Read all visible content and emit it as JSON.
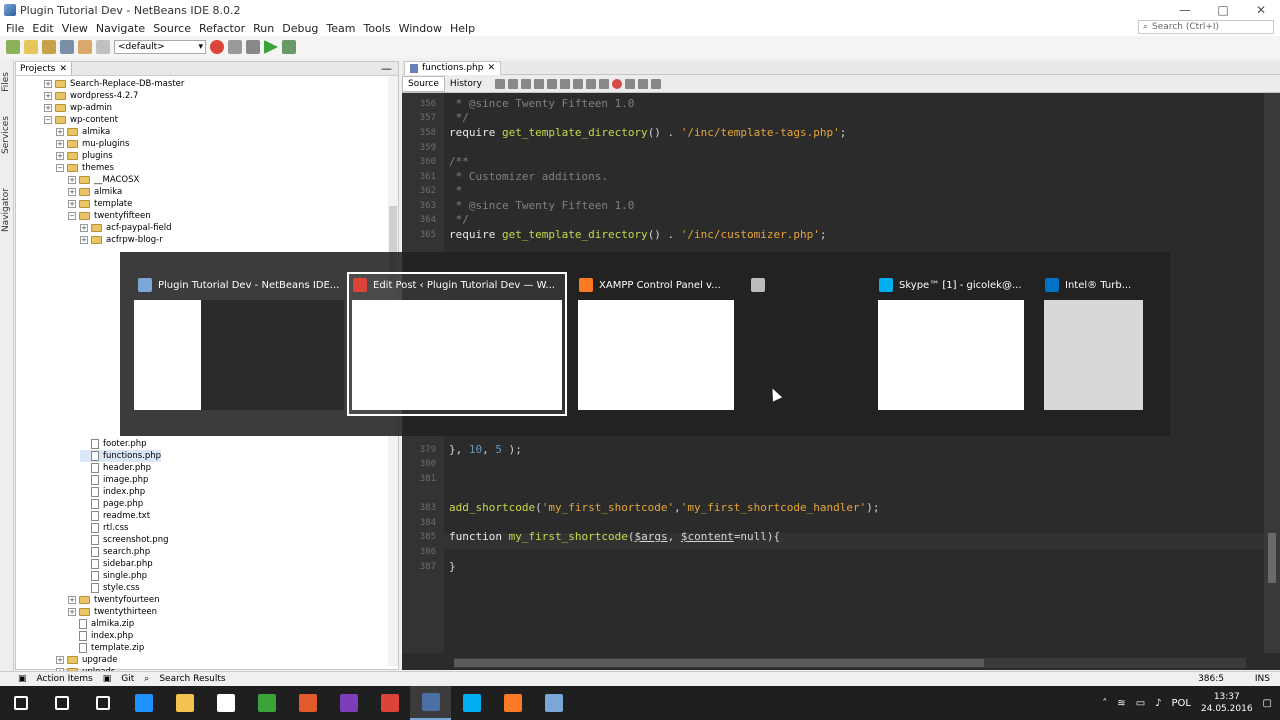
{
  "window": {
    "title": "Plugin Tutorial Dev - NetBeans IDE 8.0.2"
  },
  "menu": [
    "File",
    "Edit",
    "View",
    "Navigate",
    "Source",
    "Refactor",
    "Run",
    "Debug",
    "Team",
    "Tools",
    "Window",
    "Help"
  ],
  "search": {
    "placeholder": "Search (Ctrl+I)"
  },
  "toolbar": {
    "config": "<default>"
  },
  "side_tabs": [
    "Files",
    "Services",
    "Navigator"
  ],
  "projects": {
    "tab_label": "Projects",
    "tree": [
      {
        "label": "Search-Replace-DB-master",
        "depth": 3,
        "type": "folder"
      },
      {
        "label": "wordpress-4.2.7",
        "depth": 3,
        "type": "folder"
      },
      {
        "label": "wp-admin",
        "depth": 3,
        "type": "folder"
      },
      {
        "label": "wp-content",
        "depth": 3,
        "type": "folder",
        "open": true
      },
      {
        "label": "almika",
        "depth": 4,
        "type": "folder"
      },
      {
        "label": "mu-plugins",
        "depth": 4,
        "type": "folder"
      },
      {
        "label": "plugins",
        "depth": 4,
        "type": "folder"
      },
      {
        "label": "themes",
        "depth": 4,
        "type": "folder",
        "open": true
      },
      {
        "label": "__MACOSX",
        "depth": 5,
        "type": "folder"
      },
      {
        "label": "almika",
        "depth": 5,
        "type": "folder"
      },
      {
        "label": "template",
        "depth": 5,
        "type": "folder"
      },
      {
        "label": "twentyfifteen",
        "depth": 5,
        "type": "folder",
        "open": true
      },
      {
        "label": "acf-paypal-field",
        "depth": 6,
        "type": "folder"
      },
      {
        "label": "acfrpw-blog-r",
        "depth": 6,
        "type": "folder"
      },
      {
        "label": "footer.php",
        "depth": 6,
        "type": "file",
        "row": 30
      },
      {
        "label": "functions.php",
        "depth": 6,
        "type": "file",
        "row": 31,
        "selected": true
      },
      {
        "label": "header.php",
        "depth": 6,
        "type": "file",
        "row": 32
      },
      {
        "label": "image.php",
        "depth": 6,
        "type": "file",
        "row": 33
      },
      {
        "label": "index.php",
        "depth": 6,
        "type": "file",
        "row": 34
      },
      {
        "label": "page.php",
        "depth": 6,
        "type": "file",
        "row": 35
      },
      {
        "label": "readme.txt",
        "depth": 6,
        "type": "file",
        "row": 36
      },
      {
        "label": "rtl.css",
        "depth": 6,
        "type": "file",
        "row": 37
      },
      {
        "label": "screenshot.png",
        "depth": 6,
        "type": "file",
        "row": 38
      },
      {
        "label": "search.php",
        "depth": 6,
        "type": "file",
        "row": 39
      },
      {
        "label": "sidebar.php",
        "depth": 6,
        "type": "file",
        "row": 40
      },
      {
        "label": "single.php",
        "depth": 6,
        "type": "file",
        "row": 41
      },
      {
        "label": "style.css",
        "depth": 6,
        "type": "file",
        "row": 42
      },
      {
        "label": "twentyfourteen",
        "depth": 5,
        "type": "folder",
        "row": 43
      },
      {
        "label": "twentythirteen",
        "depth": 5,
        "type": "folder",
        "row": 44
      },
      {
        "label": "almika.zip",
        "depth": 5,
        "type": "file",
        "row": 45
      },
      {
        "label": "index.php",
        "depth": 5,
        "type": "file",
        "row": 46
      },
      {
        "label": "template.zip",
        "depth": 5,
        "type": "file",
        "row": 47
      },
      {
        "label": "upgrade",
        "depth": 4,
        "type": "folder",
        "row": 48
      },
      {
        "label": "uploads",
        "depth": 4,
        "type": "folder",
        "row": 49
      }
    ]
  },
  "editor": {
    "tab_label": "functions.php",
    "source_label": "Source",
    "history_label": "History",
    "lines": [
      {
        "n": "356",
        "code": " * @since Twenty Fifteen 1.0",
        "cls": "com"
      },
      {
        "n": "357",
        "code": " */",
        "cls": "com"
      },
      {
        "n": "358",
        "code": "require get_template_directory() . '/inc/template-tags.php';",
        "cls": "mixed1"
      },
      {
        "n": "359",
        "code": "",
        "cls": ""
      },
      {
        "n": "360",
        "code": "/**",
        "cls": "com"
      },
      {
        "n": "361",
        "code": " * Customizer additions.",
        "cls": "com"
      },
      {
        "n": "362",
        "code": " *",
        "cls": "com"
      },
      {
        "n": "363",
        "code": " * @since Twenty Fifteen 1.0",
        "cls": "com"
      },
      {
        "n": "364",
        "code": " */",
        "cls": "com"
      },
      {
        "n": "365",
        "code": "require get_template_directory() . '/inc/customizer.php';",
        "cls": "mixed2"
      },
      {
        "n": "379",
        "code": "}, 10, 5 );",
        "cls": ""
      },
      {
        "n": "380",
        "code": "",
        "cls": ""
      },
      {
        "n": "381",
        "code": "",
        "cls": ""
      },
      {
        "n": "383",
        "code": "add_shortcode('my_first_shortcode','my_first_shortcode_handler');",
        "cls": "mixed3"
      },
      {
        "n": "384",
        "code": "",
        "cls": ""
      },
      {
        "n": "385",
        "code": "function my_first_shortcode($args, $content=null){",
        "cls": "mixed4"
      },
      {
        "n": "386",
        "code": "",
        "cls": ""
      },
      {
        "n": "387",
        "code": "}",
        "cls": ""
      }
    ]
  },
  "status": {
    "action_items": "Action Items",
    "git": "Git",
    "search_results": "Search Results",
    "position": "386:5",
    "mode": "INS"
  },
  "switcher": {
    "items": [
      {
        "label": "Plugin Tutorial Dev - NetBeans IDE...",
        "icon": "netbeans-icon",
        "color": "#7aa6d8"
      },
      {
        "label": "Edit Post ‹ Plugin Tutorial Dev — W...",
        "icon": "chrome-icon",
        "color": "#db4437",
        "selected": true
      },
      {
        "label": "XAMPP Control Panel v...",
        "icon": "xampp-icon",
        "color": "#fb7a24"
      },
      {
        "label": "",
        "icon": "window-icon",
        "color": "#bbbbbb"
      },
      {
        "label": "Skype™ [1] - gicolek@...",
        "icon": "skype-icon",
        "color": "#00aff0"
      },
      {
        "label": "Intel® Turb...",
        "icon": "intel-icon",
        "color": "#0071c5"
      }
    ]
  },
  "taskbar": {
    "time": "13:37",
    "date": "24.05.2016",
    "lang": "POL",
    "apps": [
      "start-icon",
      "search-icon",
      "task-view-icon",
      "edge-icon",
      "explorer-icon",
      "store-icon",
      "app-green-icon",
      "app-orange-icon",
      "app-purple-icon",
      "chrome-icon",
      "netbeans-icon",
      "skype-icon",
      "xampp-icon",
      "box-icon"
    ]
  }
}
